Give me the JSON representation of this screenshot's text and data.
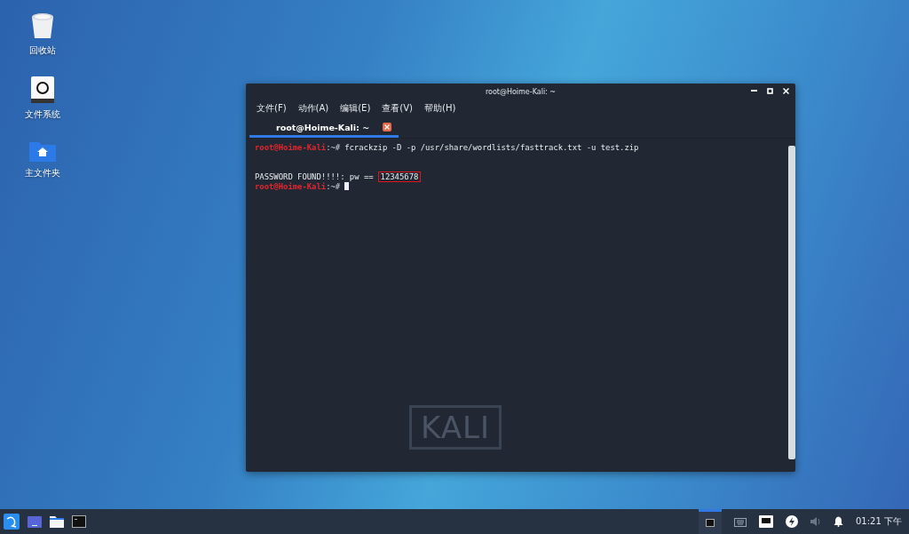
{
  "desktop_icons": [
    {
      "kind": "trash",
      "label": "回收站"
    },
    {
      "kind": "drive",
      "label": "文件系统"
    },
    {
      "kind": "home",
      "label": "主文件夹"
    }
  ],
  "window": {
    "title": "root@Hoime-Kali: ~",
    "menu": [
      "文件(F)",
      "动作(A)",
      "编辑(E)",
      "查看(V)",
      "帮助(H)"
    ],
    "tabs": [
      {
        "label": "root@Hoime-Kali: ~",
        "selected": true
      }
    ],
    "lines": [
      {
        "kind": "prompt",
        "user": "root@Hoime-Kali",
        "rest": ":~#",
        "command": "fcrackzip -D -p /usr/share/wordlists/fasttrack.txt -u test.zip"
      },
      {
        "kind": "blank"
      },
      {
        "kind": "output",
        "text": "PASSWORD FOUND!!!!: pw ==",
        "highlight": "12345678"
      },
      {
        "kind": "prompt",
        "user": "root@Hoime-Kali",
        "rest": ":~#",
        "cursor": true
      }
    ],
    "background_logo": "KALI"
  },
  "taskbar": {
    "clock": "01:21 下午"
  }
}
